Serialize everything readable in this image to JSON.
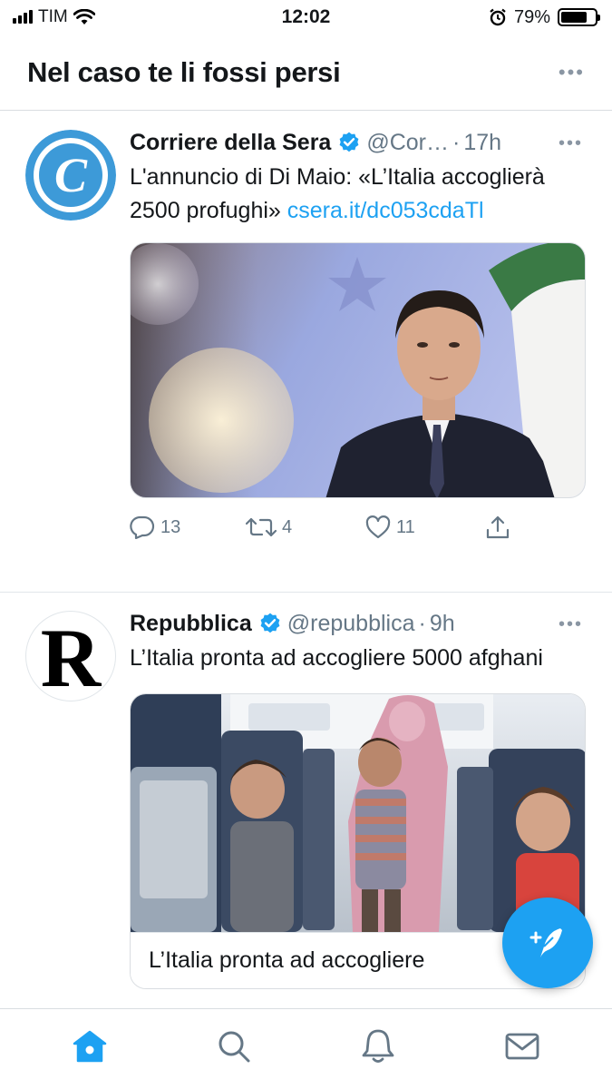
{
  "status_bar": {
    "carrier": "TIM",
    "time": "12:02",
    "battery": "79%",
    "battery_level": 0.79,
    "icons": [
      "signal-icon",
      "wifi-icon",
      "alarm-icon",
      "battery-icon"
    ]
  },
  "header": {
    "title": "Nel caso te li fossi persi",
    "more_icon": "more-horizontal-icon"
  },
  "tweets": [
    {
      "name": "Corriere della Sera",
      "verified": true,
      "handle": "@Cor…",
      "time": "17h",
      "text": "L'annuncio di Di Maio: «L’Italia accoglierà 2500 profughi»",
      "link": "csera.it/dc053cdaTl",
      "media_icon": "photo-minister-icon",
      "actions": {
        "replies": "13",
        "retweets": "4",
        "likes": "11"
      },
      "accent": "#3d9ad8"
    },
    {
      "name": "Repubblica",
      "verified": true,
      "handle": "@repubblica",
      "time": "9h",
      "text": "L’Italia pronta ad accogliere 5000 afghani",
      "avatar_letter": "R",
      "media_icon": "photo-airplane-cabin-icon",
      "card_title": "L’Italia pronta ad accogliere"
    }
  ],
  "compose_button_icon": "compose-tweet-icon",
  "tab_bar": {
    "tabs": [
      "home-icon",
      "search-icon",
      "notifications-icon",
      "messages-icon"
    ],
    "active": "home-icon"
  },
  "colors": {
    "brand": "#1da1f2",
    "text_secondary": "#657786",
    "divider": "#e1e6ea"
  }
}
